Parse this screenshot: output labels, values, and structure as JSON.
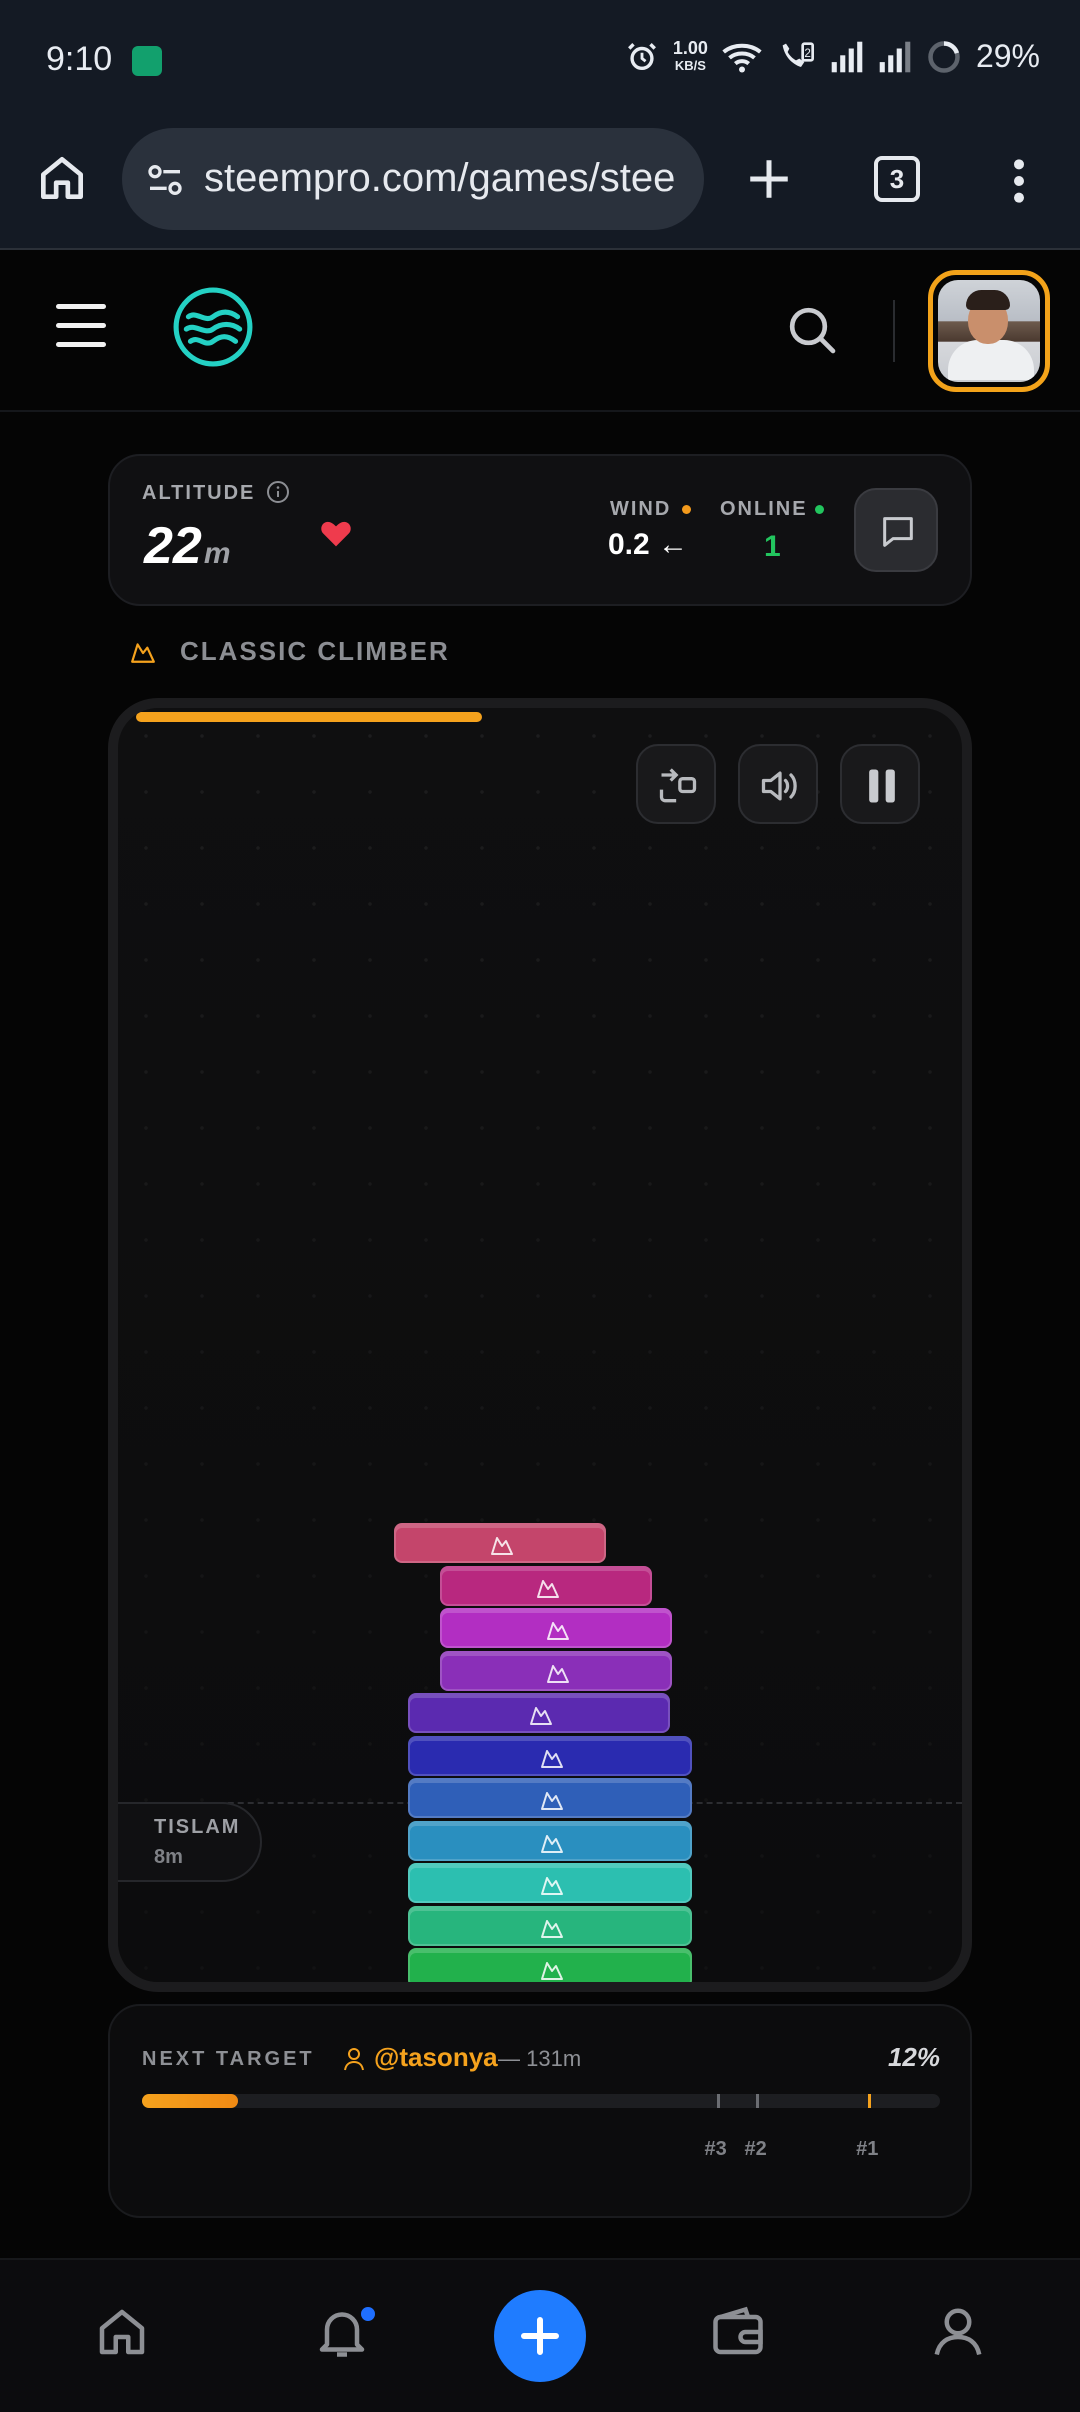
{
  "status_bar": {
    "time": "9:10",
    "net_speed_value": "1.00",
    "net_speed_unit": "KB/S",
    "battery": "29%",
    "sim_badge": "2",
    "icons": [
      "alarm-icon",
      "wifi-icon",
      "volte-call-icon",
      "signal-icon",
      "signal-icon",
      "battery-ring-icon"
    ]
  },
  "browser": {
    "url": "steempro.com/games/stee",
    "tab_count": "3",
    "icons": [
      "home-icon",
      "tune-icon",
      "plus-icon",
      "more-vert-icon"
    ]
  },
  "header": {
    "icons": [
      "menu-icon",
      "steem-logo",
      "search-icon",
      "avatar"
    ]
  },
  "stats": {
    "altitude_label": "ALTITUDE",
    "altitude_value": "22",
    "altitude_unit": "m",
    "wind_label": "WIND",
    "wind_value": "0.2 ←",
    "online_label": "ONLINE",
    "online_value": "1"
  },
  "mode": {
    "label": "CLASSIC CLIMBER"
  },
  "game": {
    "progress_fraction": 0.42,
    "marker_name": "TISLAM",
    "marker_altitude": "8m",
    "controls": [
      "swap-icon",
      "sound-icon",
      "pause-icon"
    ],
    "block_colors": [
      "#22b14c",
      "#27b57d",
      "#2cbfb0",
      "#2a8fbf",
      "#2f5fb8",
      "#2a2bb0",
      "#5b2ab0",
      "#8a2fb8",
      "#b22ec2",
      "#b8287f",
      "#c4456b"
    ]
  },
  "next_target": {
    "label": "NEXT TARGET",
    "user": "@tasonya",
    "distance": "— 131m",
    "percent": "12%",
    "progress_fraction": 0.12,
    "ranks": [
      {
        "label": "#3",
        "fraction": 0.72
      },
      {
        "label": "#2",
        "fraction": 0.77
      },
      {
        "label": "#1",
        "fraction": 0.91
      }
    ]
  },
  "bottom_nav": {
    "items": [
      "home-icon",
      "bell-icon",
      "create-icon",
      "wallet-icon",
      "profile-icon"
    ],
    "accent": "#1f7cff"
  },
  "colors": {
    "accent_orange": "#f5a21d",
    "online_green": "#22c55e"
  }
}
